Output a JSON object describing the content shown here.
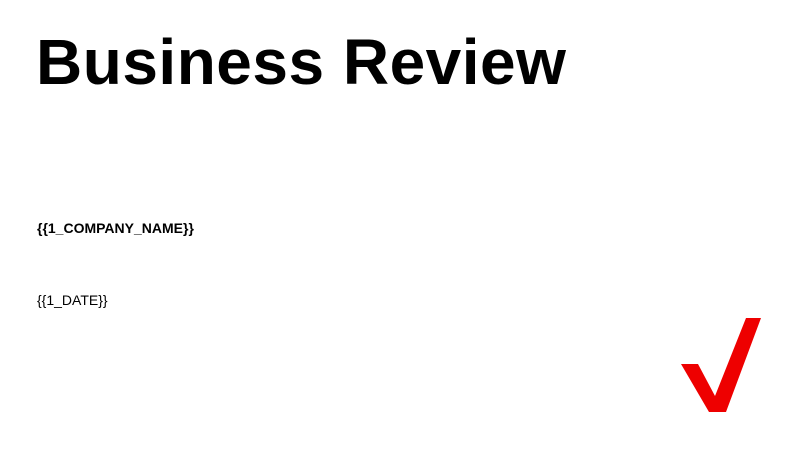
{
  "slide": {
    "title": "Business Review",
    "company_placeholder": "{{1_COMPANY_NAME}}",
    "date_placeholder": "{{1_DATE}}"
  },
  "logo": {
    "icon": "checkmark-logo-icon",
    "color": "#ee0000"
  }
}
